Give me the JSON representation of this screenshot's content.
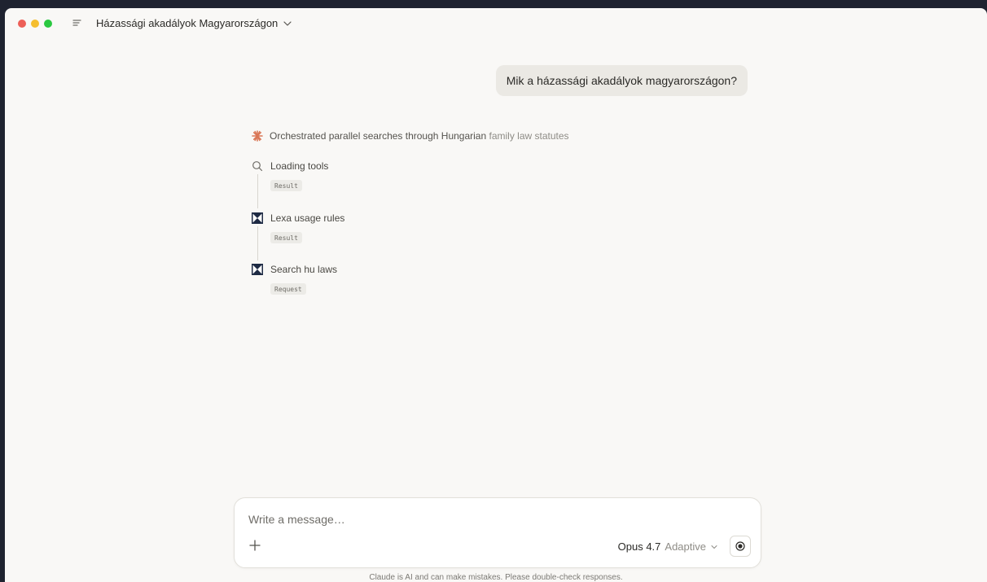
{
  "header": {
    "conversation_title": "Házassági akadályok Magyarországon",
    "icons": {
      "menu": "menu-icon",
      "title_dropdown": "chevron-down-icon"
    }
  },
  "messages": {
    "user_message": "Mik a házassági akadályok magyarországon?"
  },
  "thinking": {
    "summary_dark": "Orchestrated parallel searches through Hungarian",
    "summary_light": "family law statutes",
    "accent_color": "#d97757",
    "steps": [
      {
        "label": "Loading tools",
        "badge": "Result",
        "icon": "search-icon"
      },
      {
        "label": "Lexa usage rules",
        "badge": "Result",
        "icon": "lexa-logo-icon"
      },
      {
        "label": "Search hu laws",
        "badge": "Request",
        "icon": "lexa-logo-icon"
      }
    ]
  },
  "composer": {
    "placeholder": "Write a message…",
    "model": "Opus 4.7",
    "mode": "Adaptive",
    "icons": {
      "add": "plus-icon",
      "voice": "voice-mode-icon"
    }
  },
  "footer": {
    "disclaimer": "Claude is AI and can make mistakes. Please double-check responses."
  }
}
